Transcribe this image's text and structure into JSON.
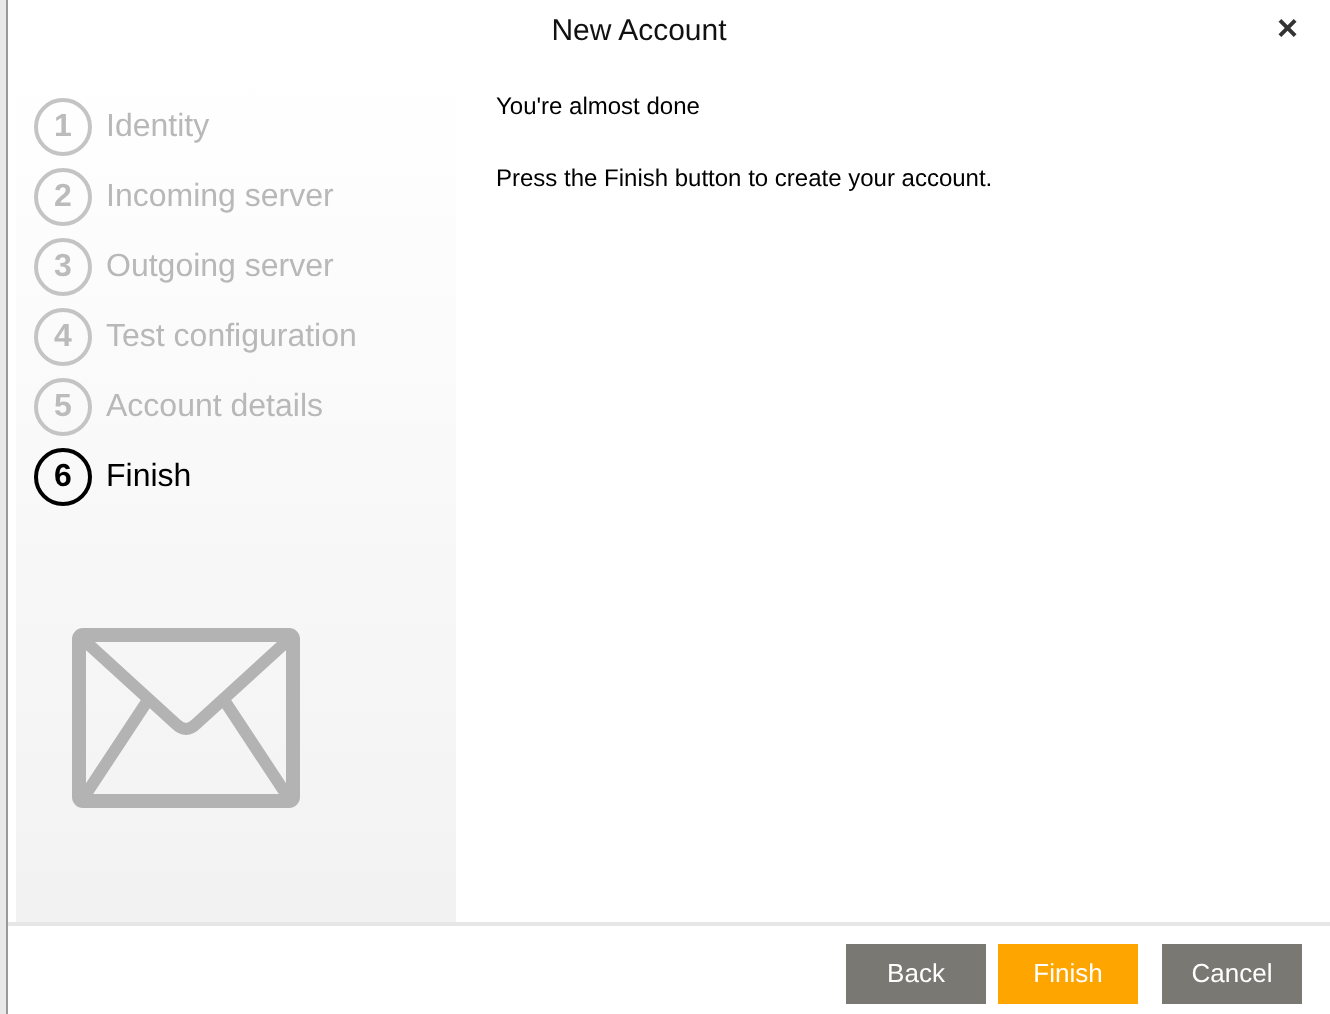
{
  "window": {
    "title": "New Account",
    "close": "×"
  },
  "steps": [
    {
      "number": "1",
      "label": "Identity",
      "selected": false
    },
    {
      "number": "2",
      "label": "Incoming server",
      "selected": false
    },
    {
      "number": "3",
      "label": "Outgoing server",
      "selected": false
    },
    {
      "number": "4",
      "label": "Test configuration",
      "selected": false
    },
    {
      "number": "5",
      "label": "Account details",
      "selected": false
    },
    {
      "number": "6",
      "label": "Finish",
      "selected": true
    }
  ],
  "content": {
    "heading": "You're almost done",
    "message": "Press the Finish button to create your account."
  },
  "buttons": [
    {
      "label": "Back",
      "kind": "normal"
    },
    {
      "label": "Finish",
      "kind": "primary"
    },
    {
      "label": "Cancel",
      "kind": "normal"
    }
  ]
}
